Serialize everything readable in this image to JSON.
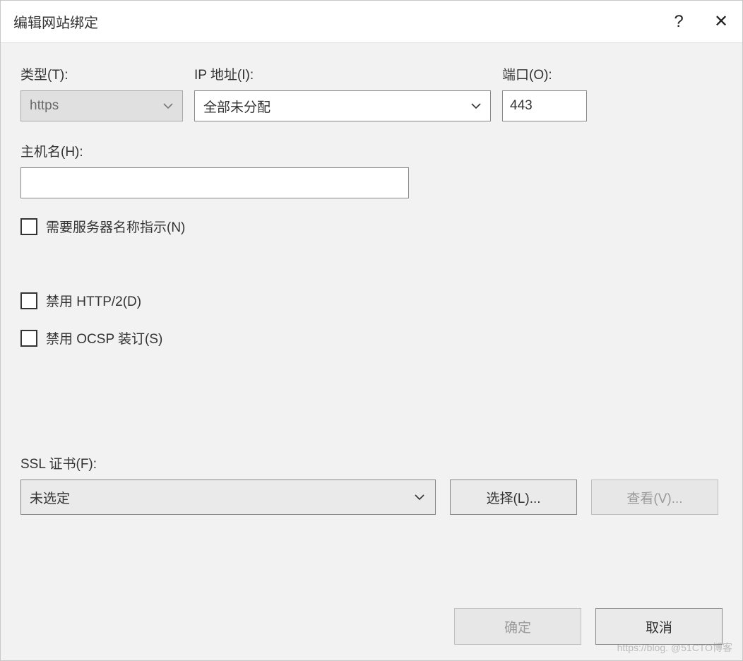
{
  "title": "编辑网站绑定",
  "titlebar": {
    "help_icon": "?",
    "close_icon": "✕"
  },
  "fields": {
    "type_label": "类型(T):",
    "type_value": "https",
    "ip_label": "IP 地址(I):",
    "ip_value": "全部未分配",
    "port_label": "端口(O):",
    "port_value": "443",
    "hostname_label": "主机名(H):",
    "hostname_value": ""
  },
  "checkboxes": {
    "sni_label": "需要服务器名称指示(N)",
    "http2_label": "禁用 HTTP/2(D)",
    "ocsp_label": "禁用 OCSP 装订(S)"
  },
  "ssl": {
    "label": "SSL 证书(F):",
    "value": "未选定",
    "select_btn": "选择(L)...",
    "view_btn": "查看(V)..."
  },
  "footer": {
    "ok": "确定",
    "cancel": "取消"
  },
  "watermark": "https://blog. @51CTO博客"
}
